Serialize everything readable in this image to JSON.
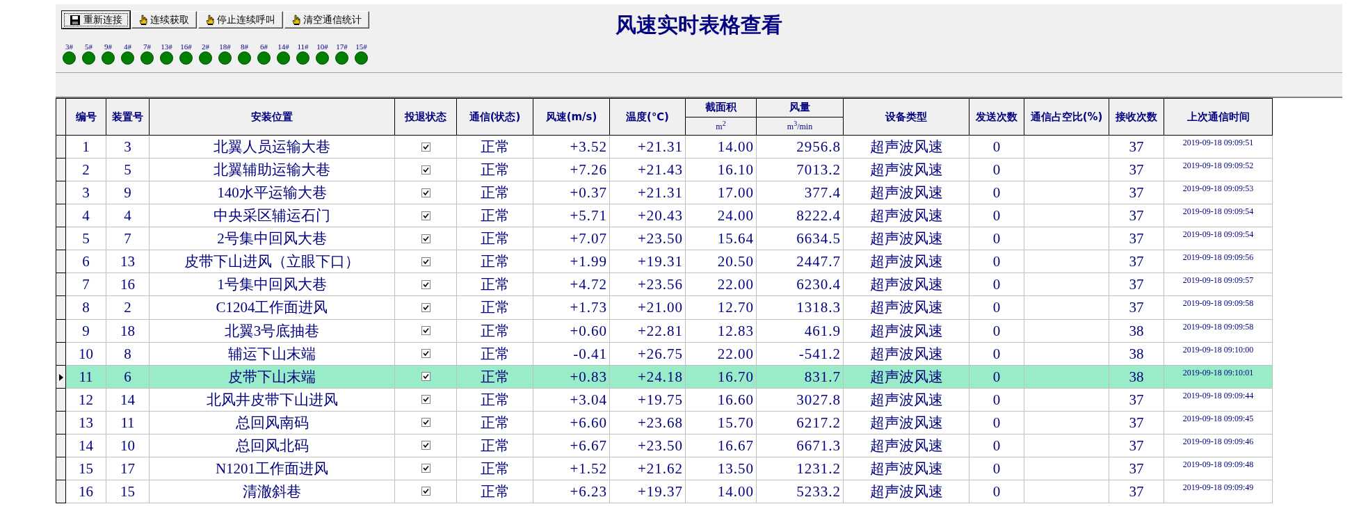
{
  "toolbar": {
    "buttons": [
      {
        "label": "重新连接",
        "kind": "disk",
        "focused": true
      },
      {
        "label": "连续获取",
        "kind": "hand",
        "focused": false
      },
      {
        "label": "停止连续呼叫",
        "kind": "hand",
        "focused": false
      },
      {
        "label": "清空通信统计",
        "kind": "hand",
        "focused": false
      }
    ]
  },
  "title": "风速实时表格查看",
  "devices": [
    {
      "label": "3#",
      "color": "#008000"
    },
    {
      "label": "5#",
      "color": "#008000"
    },
    {
      "label": "9#",
      "color": "#008000"
    },
    {
      "label": "4#",
      "color": "#008000"
    },
    {
      "label": "7#",
      "color": "#008000"
    },
    {
      "label": "13#",
      "color": "#008000"
    },
    {
      "label": "16#",
      "color": "#008000"
    },
    {
      "label": "2#",
      "color": "#008000"
    },
    {
      "label": "18#",
      "color": "#008000"
    },
    {
      "label": "8#",
      "color": "#008000"
    },
    {
      "label": "6#",
      "color": "#008000"
    },
    {
      "label": "14#",
      "color": "#008000"
    },
    {
      "label": "11#",
      "color": "#008000"
    },
    {
      "label": "10#",
      "color": "#008000"
    },
    {
      "label": "17#",
      "color": "#008000"
    },
    {
      "label": "15#",
      "color": "#008000"
    }
  ],
  "table": {
    "columns": [
      {
        "label": "编号"
      },
      {
        "label": "装置号"
      },
      {
        "label": "安装位置"
      },
      {
        "label": "投退状态"
      },
      {
        "label": "通信(状态)"
      },
      {
        "label": "风速(m/s)"
      },
      {
        "label": "温度(℃)"
      },
      {
        "label": "截面积",
        "unit": "m$^{2}$"
      },
      {
        "label": "风量",
        "unit": "m$^{3}$/min"
      },
      {
        "label": "设备类型"
      },
      {
        "label": "发送次数"
      },
      {
        "label": "通信占空比(%)"
      },
      {
        "label": "接收次数"
      },
      {
        "label": "上次通信时间"
      }
    ],
    "rows": [
      {
        "no": "1",
        "device": "3",
        "location": "北翼人员运输大巷",
        "enabled": true,
        "comm": "正常",
        "speed": "+3.52",
        "temp": "+21.31",
        "area": "14.00",
        "flow": "2956.8",
        "type": "超声波风速",
        "sent": "0",
        "received": "37",
        "time": "2019-09-18 09:09:51",
        "selected": false
      },
      {
        "no": "2",
        "device": "5",
        "location": "北翼辅助运输大巷",
        "enabled": true,
        "comm": "正常",
        "speed": "+7.26",
        "temp": "+21.43",
        "area": "16.10",
        "flow": "7013.2",
        "type": "超声波风速",
        "sent": "0",
        "received": "37",
        "time": "2019-09-18 09:09:52",
        "selected": false
      },
      {
        "no": "3",
        "device": "9",
        "location": "140水平运输大巷",
        "enabled": true,
        "comm": "正常",
        "speed": "+0.37",
        "temp": "+21.31",
        "area": "17.00",
        "flow": "377.4",
        "type": "超声波风速",
        "sent": "0",
        "received": "37",
        "time": "2019-09-18 09:09:53",
        "selected": false
      },
      {
        "no": "4",
        "device": "4",
        "location": "中央采区辅运石门",
        "enabled": true,
        "comm": "正常",
        "speed": "+5.71",
        "temp": "+20.43",
        "area": "24.00",
        "flow": "8222.4",
        "type": "超声波风速",
        "sent": "0",
        "received": "37",
        "time": "2019-09-18 09:09:54",
        "selected": false
      },
      {
        "no": "5",
        "device": "7",
        "location": "2号集中回风大巷",
        "enabled": true,
        "comm": "正常",
        "speed": "+7.07",
        "temp": "+23.50",
        "area": "15.64",
        "flow": "6634.5",
        "type": "超声波风速",
        "sent": "0",
        "received": "37",
        "time": "2019-09-18 09:09:54",
        "selected": false
      },
      {
        "no": "6",
        "device": "13",
        "location": "皮带下山进风（立眼下口）",
        "enabled": true,
        "comm": "正常",
        "speed": "+1.99",
        "temp": "+19.31",
        "area": "20.50",
        "flow": "2447.7",
        "type": "超声波风速",
        "sent": "0",
        "received": "37",
        "time": "2019-09-18 09:09:56",
        "selected": false
      },
      {
        "no": "7",
        "device": "16",
        "location": "1号集中回风大巷",
        "enabled": true,
        "comm": "正常",
        "speed": "+4.72",
        "temp": "+23.56",
        "area": "22.00",
        "flow": "6230.4",
        "type": "超声波风速",
        "sent": "0",
        "received": "37",
        "time": "2019-09-18 09:09:57",
        "selected": false
      },
      {
        "no": "8",
        "device": "2",
        "location": "C1204工作面进风",
        "enabled": true,
        "comm": "正常",
        "speed": "+1.73",
        "temp": "+21.00",
        "area": "12.70",
        "flow": "1318.3",
        "type": "超声波风速",
        "sent": "0",
        "received": "37",
        "time": "2019-09-18 09:09:58",
        "selected": false
      },
      {
        "no": "9",
        "device": "18",
        "location": "北翼3号底抽巷",
        "enabled": true,
        "comm": "正常",
        "speed": "+0.60",
        "temp": "+22.81",
        "area": "12.83",
        "flow": "461.9",
        "type": "超声波风速",
        "sent": "0",
        "received": "38",
        "time": "2019-09-18 09:09:58",
        "selected": false
      },
      {
        "no": "10",
        "device": "8",
        "location": "辅运下山末端",
        "enabled": true,
        "comm": "正常",
        "speed": "-0.41",
        "temp": "+26.75",
        "area": "22.00",
        "flow": "-541.2",
        "type": "超声波风速",
        "sent": "0",
        "received": "38",
        "time": "2019-09-18 09:10:00",
        "selected": false
      },
      {
        "no": "11",
        "device": "6",
        "location": "皮带下山末端",
        "enabled": true,
        "comm": "正常",
        "speed": "+0.83",
        "temp": "+24.18",
        "area": "16.70",
        "flow": "831.7",
        "type": "超声波风速",
        "sent": "0",
        "received": "38",
        "time": "2019-09-18 09:10:01",
        "selected": true
      },
      {
        "no": "12",
        "device": "14",
        "location": "北风井皮带下山进风",
        "enabled": true,
        "comm": "正常",
        "speed": "+3.04",
        "temp": "+19.75",
        "area": "16.60",
        "flow": "3027.8",
        "type": "超声波风速",
        "sent": "0",
        "received": "37",
        "time": "2019-09-18 09:09:44",
        "selected": false
      },
      {
        "no": "13",
        "device": "11",
        "location": "总回风南码",
        "enabled": true,
        "comm": "正常",
        "speed": "+6.60",
        "temp": "+23.68",
        "area": "15.70",
        "flow": "6217.2",
        "type": "超声波风速",
        "sent": "0",
        "received": "37",
        "time": "2019-09-18 09:09:45",
        "selected": false
      },
      {
        "no": "14",
        "device": "10",
        "location": "总回风北码",
        "enabled": true,
        "comm": "正常",
        "speed": "+6.67",
        "temp": "+23.50",
        "area": "16.67",
        "flow": "6671.3",
        "type": "超声波风速",
        "sent": "0",
        "received": "37",
        "time": "2019-09-18 09:09:46",
        "selected": false
      },
      {
        "no": "15",
        "device": "17",
        "location": "N1201工作面进风",
        "enabled": true,
        "comm": "正常",
        "speed": "+1.52",
        "temp": "+21.62",
        "area": "13.50",
        "flow": "1231.2",
        "type": "超声波风速",
        "sent": "0",
        "received": "37",
        "time": "2019-09-18 09:09:48",
        "selected": false
      },
      {
        "no": "16",
        "device": "15",
        "location": "清澈斜巷",
        "enabled": true,
        "comm": "正常",
        "speed": "+6.23",
        "temp": "+19.37",
        "area": "14.00",
        "flow": "5233.2",
        "type": "超声波风速",
        "sent": "0",
        "received": "37",
        "time": "2019-09-18 09:09:49",
        "selected": false
      }
    ]
  }
}
